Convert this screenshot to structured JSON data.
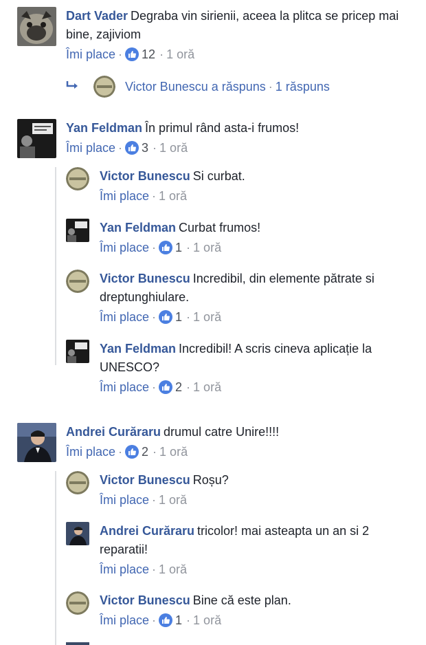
{
  "labels": {
    "like": "Îmi place"
  },
  "threads": [
    {
      "author": "Dart Vader",
      "text": "Degraba vin sirienii, aceea la plitca se pricep mai bine, zajiviom",
      "likes": "12",
      "time": "1 oră",
      "replies_summary": {
        "text": "Victor Bunescu a răspuns",
        "count": "1 răspuns"
      }
    },
    {
      "author": "Yan Feldman",
      "text": "În primul rând asta-i frumos!",
      "likes": "3",
      "time": "1 oră",
      "replies": [
        {
          "author": "Victor Bunescu",
          "text": "Si curbat.",
          "likes": "",
          "time": "1 oră"
        },
        {
          "author": "Yan Feldman",
          "text": "Curbat frumos!",
          "likes": "1",
          "time": "1 oră"
        },
        {
          "author": "Victor Bunescu",
          "text": "Incredibil, din elemente pătrate si dreptunghiulare.",
          "likes": "1",
          "time": "1 oră"
        },
        {
          "author": "Yan Feldman",
          "text": "Incredibil! A scris cineva aplicație la UNESCO?",
          "likes": "2",
          "time": "1 oră"
        }
      ]
    },
    {
      "author": "Andrei Curăraru",
      "text": "drumul catre Unire!!!!",
      "likes": "2",
      "time": "1 oră",
      "replies": [
        {
          "author": "Victor Bunescu",
          "text": "Roșu?",
          "likes": "",
          "time": "1 oră"
        },
        {
          "author": "Andrei Curăraru",
          "text": "tricolor! mai asteapta un an si 2 reparatii!",
          "likes": "",
          "time": "1 oră"
        },
        {
          "author": "Victor Bunescu",
          "text": "Bine că este plan.",
          "likes": "1",
          "time": "1 oră"
        }
      ]
    }
  ],
  "colors": {
    "name": "#365899",
    "link": "#4267b2",
    "meta": "#90949c",
    "like_badge": "#4b7fe1"
  }
}
